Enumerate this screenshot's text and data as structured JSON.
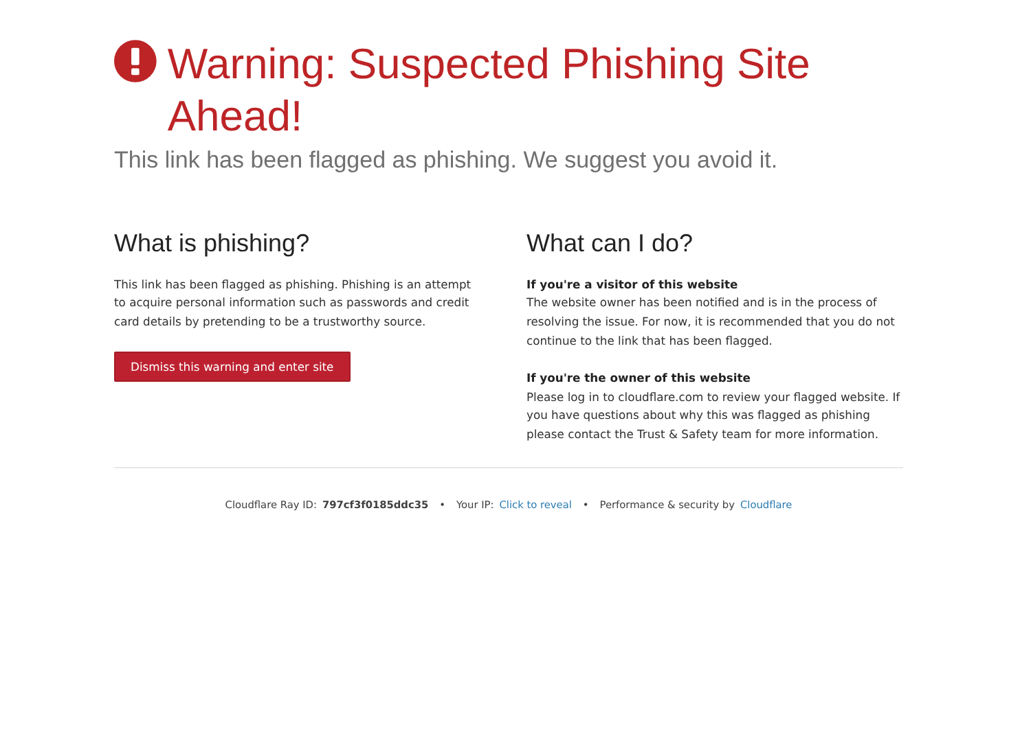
{
  "title": "Warning: Suspected Phishing Site Ahead!",
  "subtitle": "This link has been flagged as phishing. We suggest you avoid it.",
  "left": {
    "heading": "What is phishing?",
    "text": "This link has been flagged as phishing. Phishing is an attempt to acquire personal information such as passwords and credit card details by pretending to be a trustworthy source.",
    "button": "Dismiss this warning and enter site"
  },
  "right": {
    "heading": "What can I do?",
    "sections": [
      {
        "heading": "If you're a visitor of this website",
        "text": "The website owner has been notified and is in the process of resolving the issue. For now, it is recommended that you do not continue to the link that has been flagged."
      },
      {
        "heading": "If you're the owner of this website",
        "text": "Please log in to cloudflare.com to review your flagged website. If you have questions about why this was flagged as phishing please contact the Trust & Safety team for more information."
      }
    ]
  },
  "footer": [
    {
      "kind": "id",
      "label": "Cloudflare Ray ID:",
      "value": "797cf3f0185ddc35"
    },
    {
      "kind": "sep",
      "label": "•"
    },
    {
      "kind": "link",
      "label": "Your IP:",
      "value": "Click to reveal"
    },
    {
      "kind": "sep",
      "label": "•"
    },
    {
      "kind": "link",
      "label": "Performance & security by",
      "value": "Cloudflare"
    }
  ]
}
